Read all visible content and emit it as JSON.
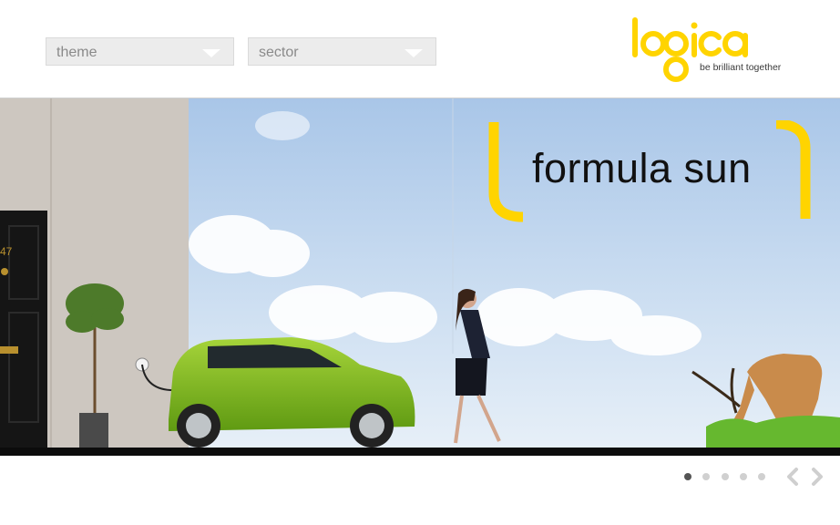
{
  "filters": {
    "theme": {
      "label": "theme"
    },
    "sector": {
      "label": "sector"
    }
  },
  "brand": {
    "name": "logica",
    "tagline": "be brilliant together",
    "color": "#ffd400"
  },
  "banner": {
    "headline": "formula sun",
    "door_number": "47",
    "accent": "#ffd400"
  },
  "carousel": {
    "slides": 5,
    "active_index": 0,
    "prev_icon": "chevron-left-icon",
    "next_icon": "chevron-right-icon"
  }
}
